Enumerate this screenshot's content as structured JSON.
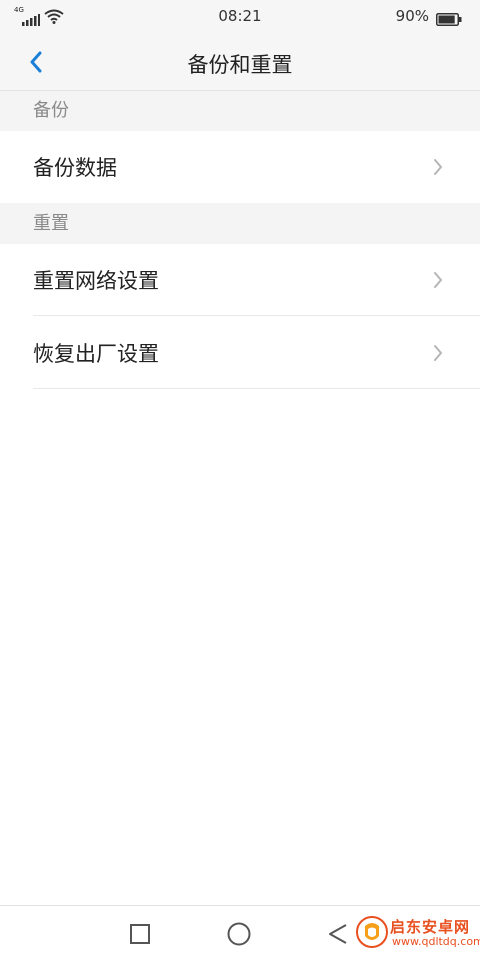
{
  "status_bar": {
    "network_type": "4G",
    "time": "08:21",
    "battery_percent": "90%",
    "battery_level": 0.9
  },
  "header": {
    "title": "备份和重置"
  },
  "sections": [
    {
      "title": "备份",
      "items": [
        {
          "label": "备份数据"
        }
      ]
    },
    {
      "title": "重置",
      "items": [
        {
          "label": "重置网络设置"
        },
        {
          "label": "恢复出厂设置"
        }
      ]
    }
  ],
  "watermark": {
    "name": "启东安卓网",
    "url": "www.qdltdq.com"
  },
  "colors": {
    "accent": "#1a7fd6",
    "watermark": "#e8501f"
  }
}
